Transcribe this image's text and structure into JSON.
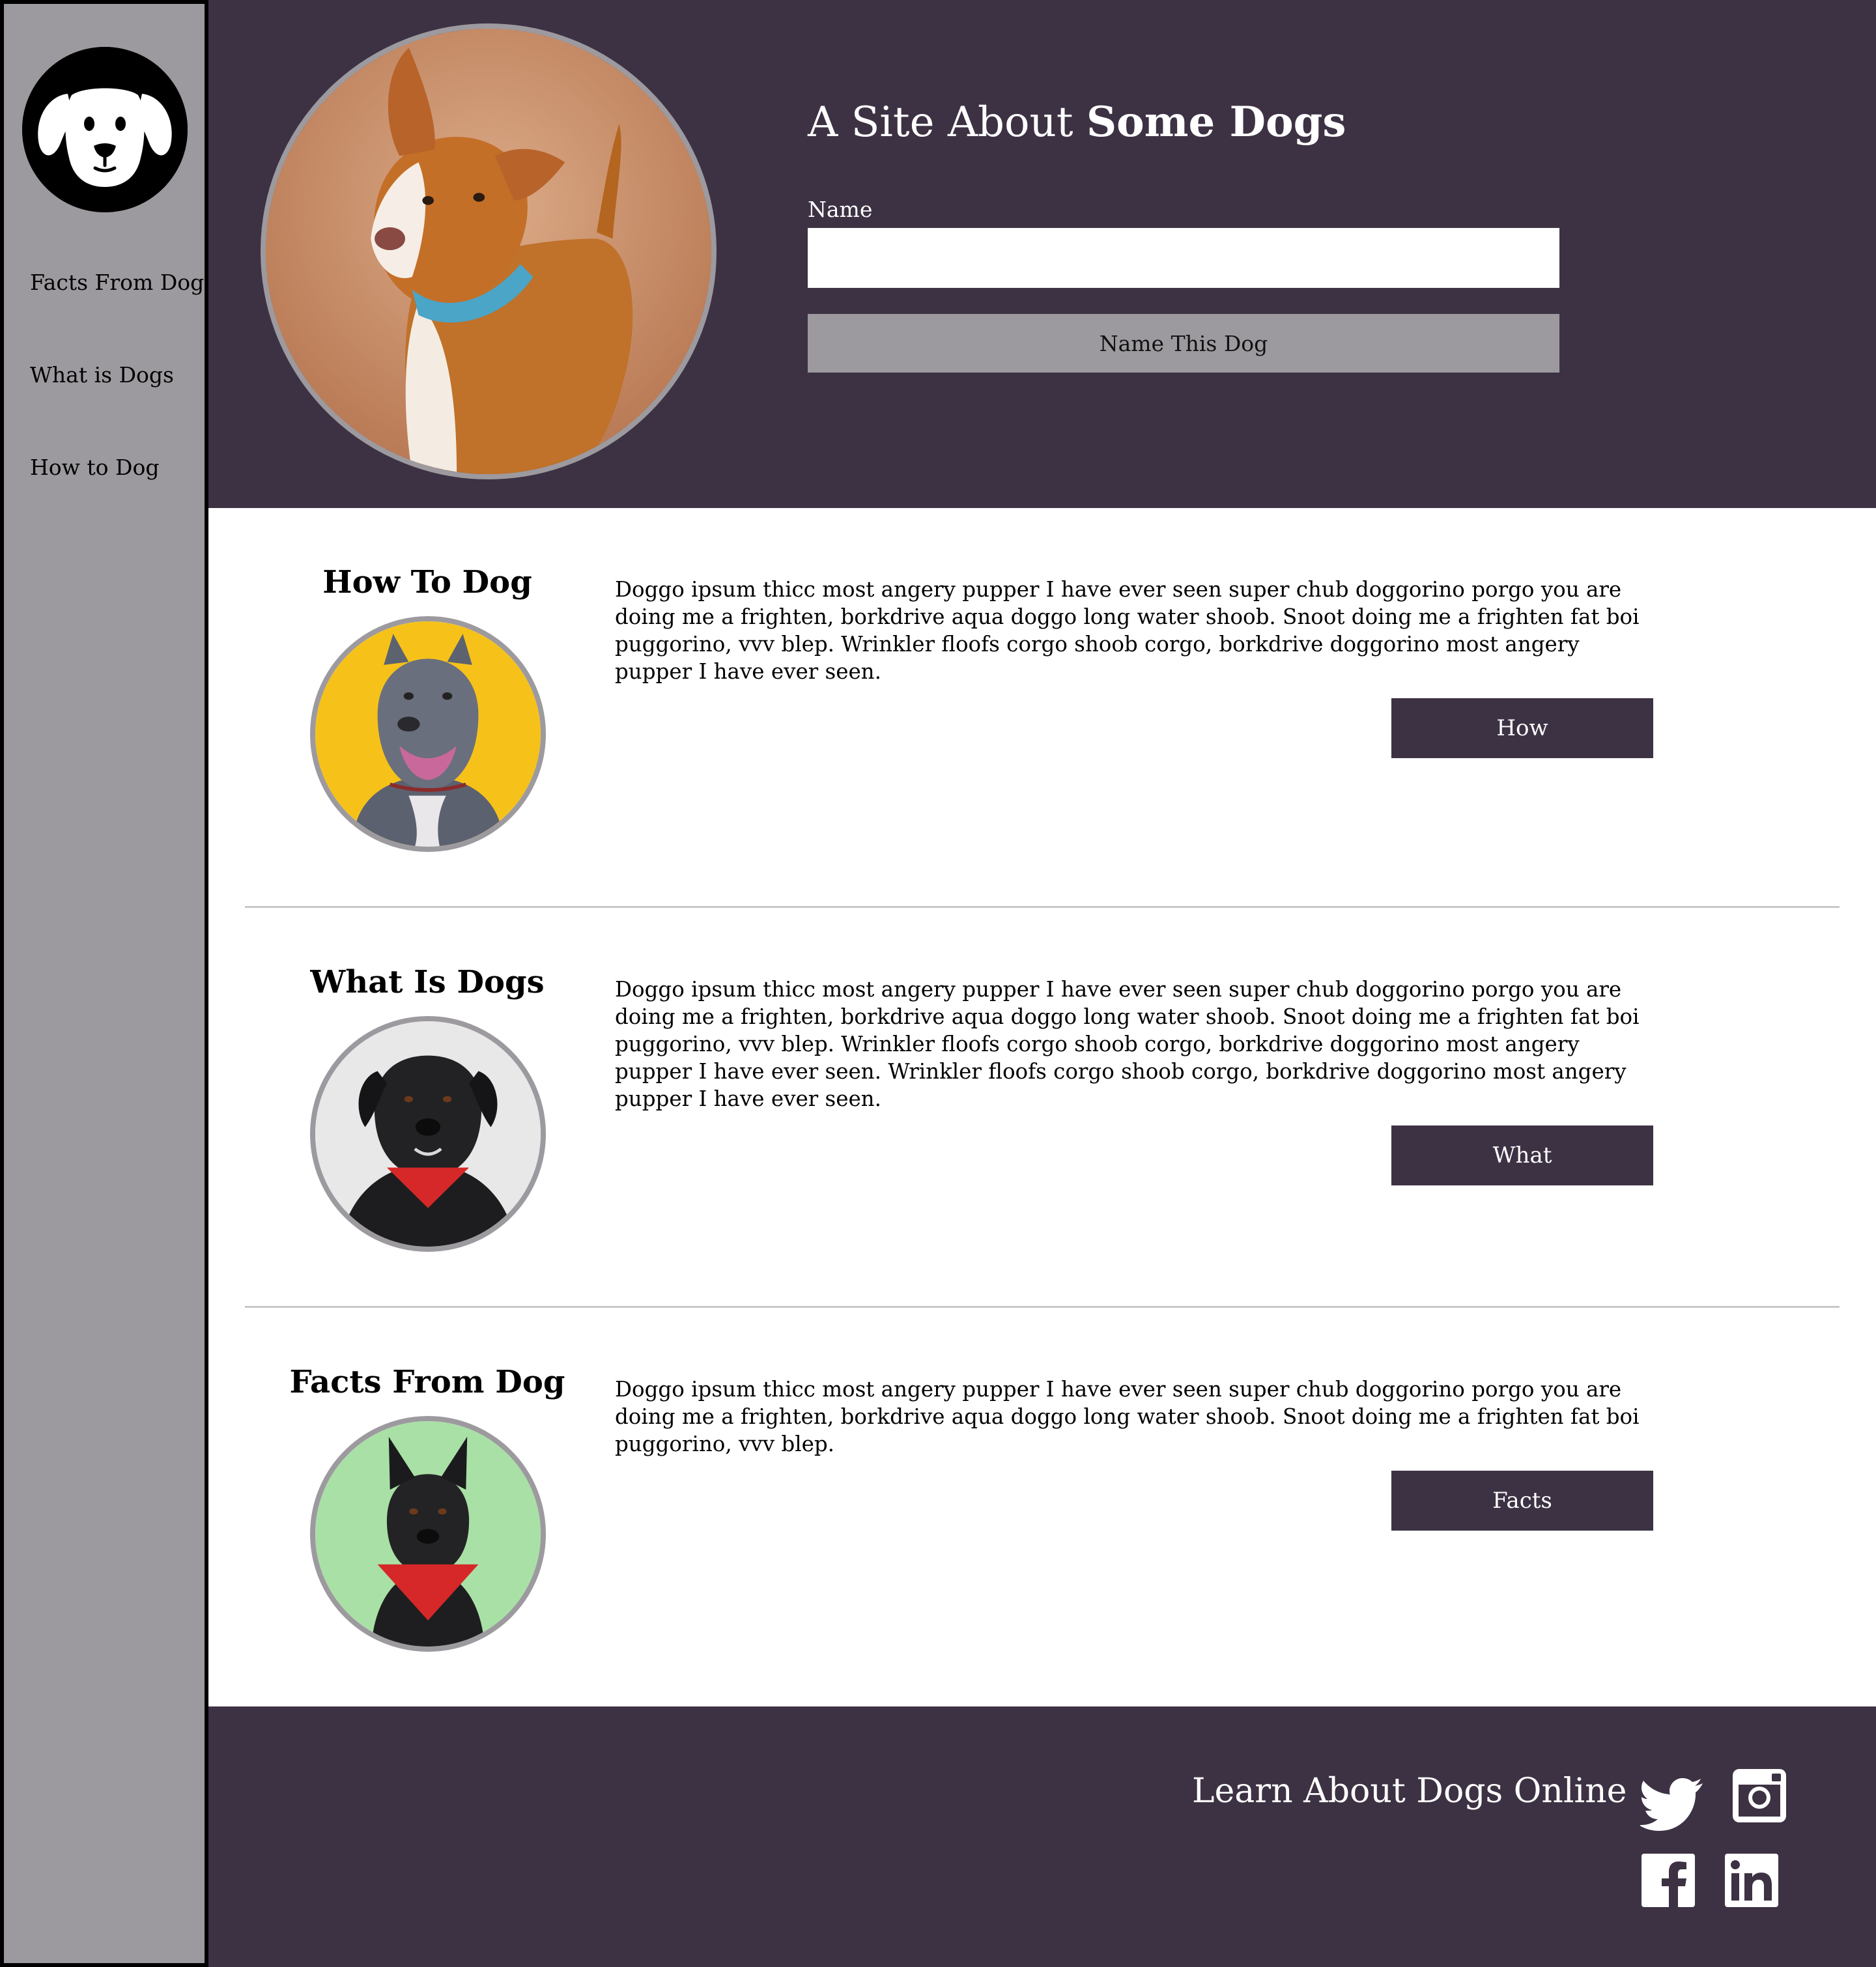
{
  "sidebar": {
    "items": [
      {
        "label": "Facts From Dog"
      },
      {
        "label": "What is Dogs"
      },
      {
        "label": "How to Dog"
      }
    ]
  },
  "header": {
    "title_light": "A Site About ",
    "title_bold": "Some Dogs",
    "name_label": "Name",
    "name_value": "",
    "name_button": "Name This Dog"
  },
  "sections": [
    {
      "title": "How To Dog",
      "text": "Doggo ipsum thicc most angery pupper I have ever seen super chub doggorino porgo you are doing me a frighten, borkdrive aqua doggo long water shoob. Snoot doing me a frighten fat boi puggorino, vvv blep. Wrinkler floofs corgo shoob corgo, borkdrive doggorino most angery pupper I have ever seen.",
      "button": "How"
    },
    {
      "title": "What Is Dogs",
      "text": "Doggo ipsum thicc most angery pupper I have ever seen super chub doggorino porgo you are doing me a frighten, borkdrive aqua doggo long water shoob. Snoot doing me a frighten fat boi puggorino, vvv blep. Wrinkler floofs corgo shoob corgo, borkdrive doggorino most angery pupper I have ever seen. Wrinkler floofs corgo shoob corgo, borkdrive doggorino most angery pupper I have ever seen.",
      "button": "What"
    },
    {
      "title": "Facts From Dog",
      "text": "Doggo ipsum thicc most angery pupper I have ever seen super chub doggorino porgo you are doing me a frighten, borkdrive aqua doggo long water shoob. Snoot doing me a frighten fat boi puggorino, vvv blep.",
      "button": "Facts"
    }
  ],
  "footer": {
    "text": "Learn About Dogs Online",
    "icons": [
      "twitter-icon",
      "instagram-icon",
      "facebook-icon",
      "linkedin-icon"
    ]
  },
  "colors": {
    "dark_purple": "#3d3243",
    "sidebar_gray": "#9d9a9f",
    "white": "#ffffff"
  }
}
